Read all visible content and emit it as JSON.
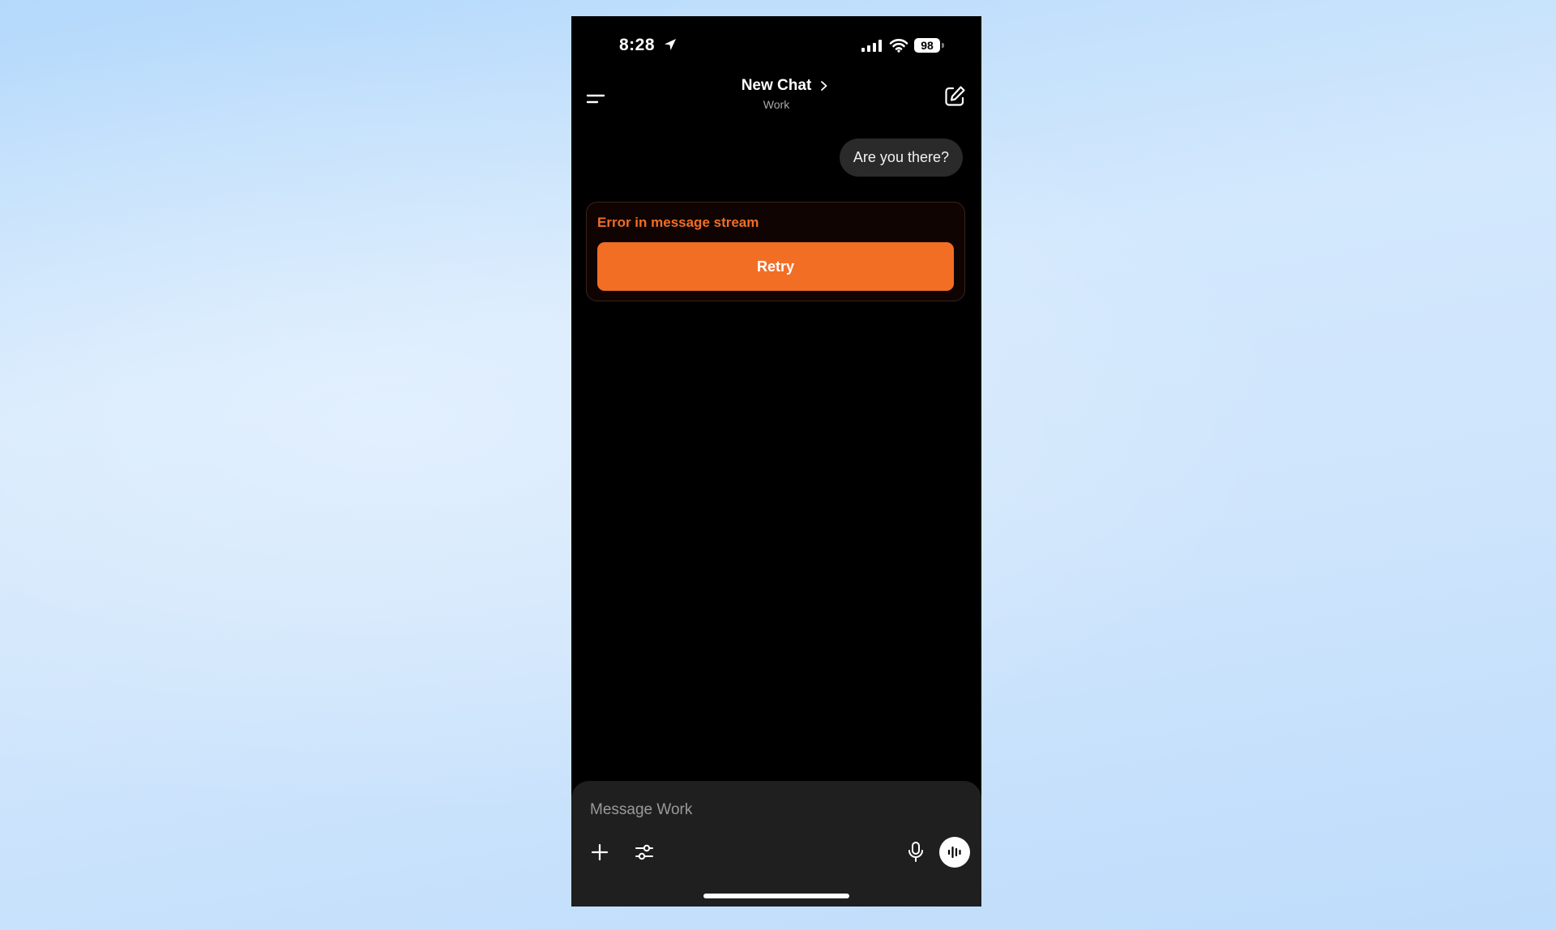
{
  "status_bar": {
    "time": "8:28",
    "battery": "98",
    "icons": [
      "location-arrow-icon",
      "signal-icon",
      "wifi-icon",
      "battery-icon"
    ]
  },
  "header": {
    "title": "New Chat",
    "subtitle": "Work",
    "icons": [
      "menu-icon",
      "chevron-right-icon",
      "compose-icon"
    ]
  },
  "conversation": {
    "user_message": "Are you there?"
  },
  "error": {
    "message": "Error in message stream",
    "retry_label": "Retry"
  },
  "composer": {
    "placeholder": "Message Work",
    "value": "",
    "icons": [
      "plus-icon",
      "sliders-icon",
      "microphone-icon",
      "voice-mode-icon"
    ]
  },
  "colors": {
    "accent": "#f26e25",
    "background": "#000000",
    "bubble": "#2a2a2a",
    "composer": "#1f1f1f",
    "backdrop": "#cfe5fc"
  }
}
